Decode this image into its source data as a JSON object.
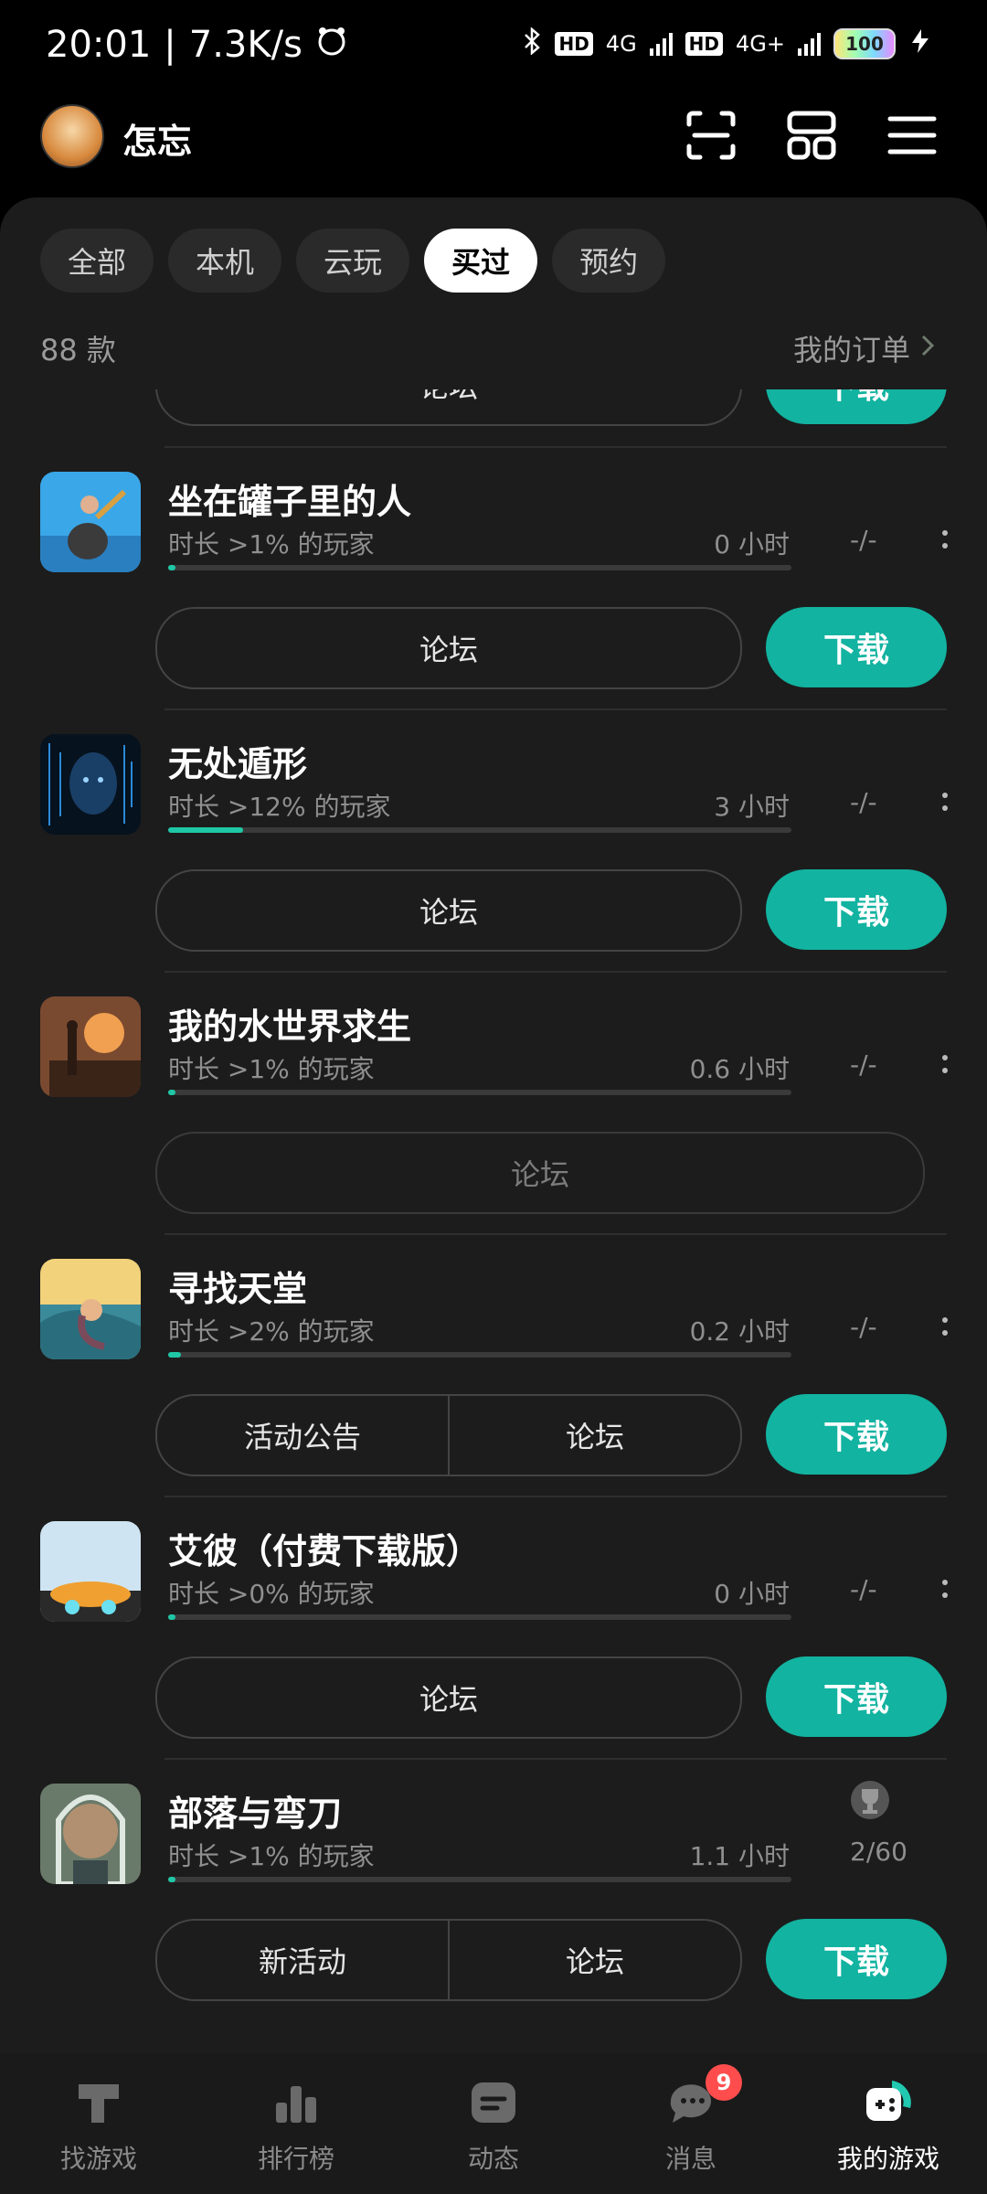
{
  "status_bar": {
    "time": "20:01",
    "net_speed": "7.3K/s",
    "net1": "4G",
    "net2": "4G+",
    "hd": "HD",
    "battery": "100"
  },
  "header": {
    "username": "怎忘"
  },
  "tabs": [
    {
      "label": "全部",
      "active": false
    },
    {
      "label": "本机",
      "active": false
    },
    {
      "label": "云玩",
      "active": false
    },
    {
      "label": "买过",
      "active": true
    },
    {
      "label": "预约",
      "active": false
    }
  ],
  "summary": {
    "count": "88 款",
    "orders_label": "我的订单"
  },
  "partial_top": {
    "forum": "论坛",
    "download": "下载"
  },
  "games": [
    {
      "name": "坐在罐子里的人",
      "stat": "时长 >1% 的玩家",
      "hours": "0 小时",
      "progress": 0.01,
      "ach": "-/-",
      "buttons": [
        "论坛"
      ],
      "download": "下载"
    },
    {
      "name": "无处遁形",
      "stat": "时长 >12% 的玩家",
      "hours": "3 小时",
      "progress": 0.12,
      "ach": "-/-",
      "buttons": [
        "论坛"
      ],
      "download": "下载"
    },
    {
      "name": "我的水世界求生",
      "stat": "时长 >1% 的玩家",
      "hours": "0.6 小时",
      "progress": 0.01,
      "ach": "-/-",
      "buttons": [
        "论坛"
      ],
      "download": ""
    },
    {
      "name": "寻找天堂",
      "stat": "时长 >2% 的玩家",
      "hours": "0.2 小时",
      "progress": 0.02,
      "ach": "-/-",
      "buttons": [
        "活动公告",
        "论坛"
      ],
      "download": "下载"
    },
    {
      "name": "艾彼（付费下载版）",
      "stat": "时长 >0% 的玩家",
      "hours": "0 小时",
      "progress": 0.0,
      "ach": "-/-",
      "buttons": [
        "论坛"
      ],
      "download": "下载"
    },
    {
      "name": "部落与弯刀",
      "stat": "时长 >1% 的玩家",
      "hours": "1.1 小时",
      "progress": 0.01,
      "ach": "2/60",
      "buttons": [
        "新活动",
        "论坛"
      ],
      "download": "下载"
    }
  ],
  "nav": [
    {
      "label": "找游戏",
      "icon": "find-game-icon",
      "active": false
    },
    {
      "label": "排行榜",
      "icon": "ranking-icon",
      "active": false
    },
    {
      "label": "动态",
      "icon": "feed-icon",
      "active": false
    },
    {
      "label": "消息",
      "icon": "message-icon",
      "active": false,
      "badge": "9"
    },
    {
      "label": "我的游戏",
      "icon": "my-games-icon",
      "active": true
    }
  ],
  "colors": {
    "accent": "#12b3a0",
    "progress": "#1fc7a6",
    "badge": "#ff4d4d",
    "panel": "#1c1c1c"
  }
}
